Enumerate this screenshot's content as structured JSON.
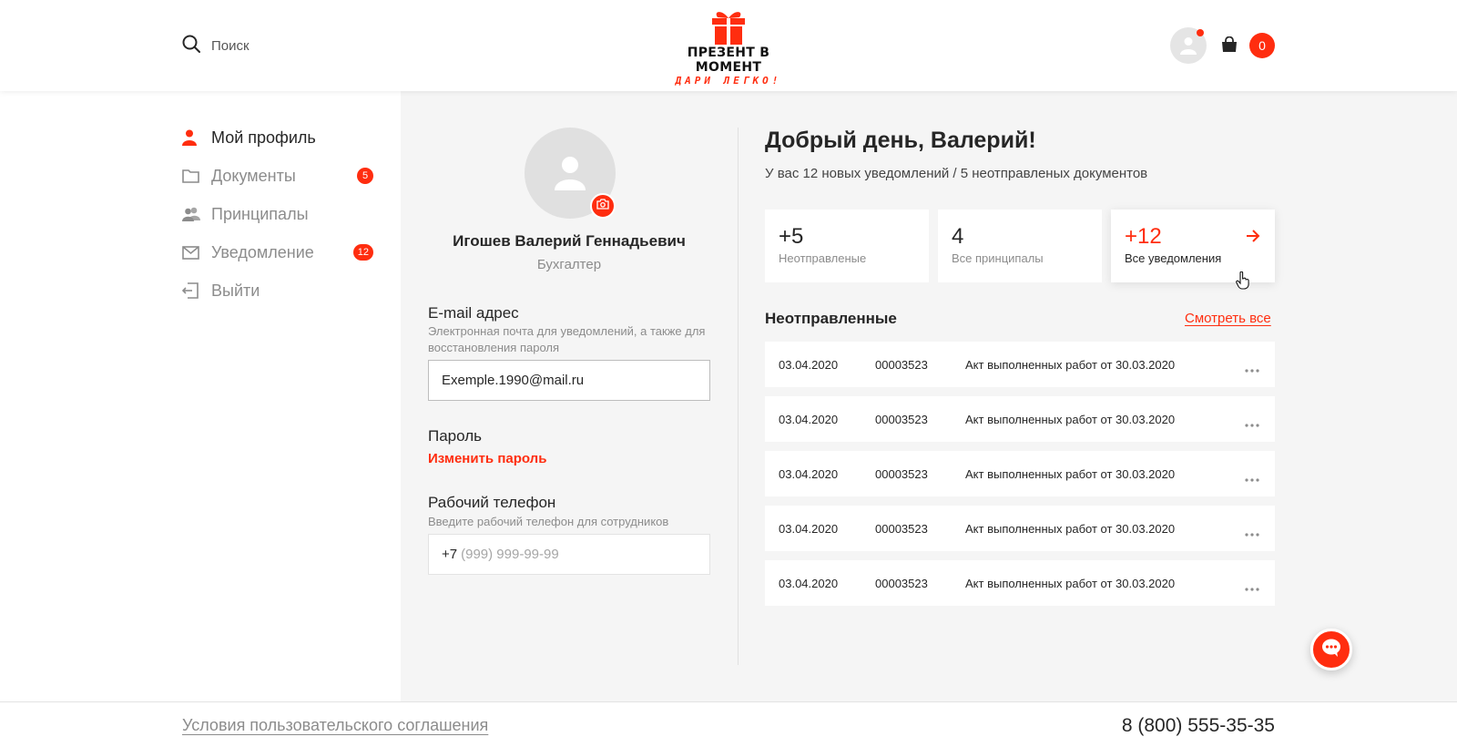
{
  "colors": {
    "accent": "#ff2d0f",
    "sidebar_bg": "#ffffff",
    "main_bg": "#f5f5f5",
    "text": "#262626",
    "muted": "#8c8c8c"
  },
  "header": {
    "search_label": "Поиск",
    "search_icon": "search-icon",
    "logo_title": "ПРЕЗЕНТ В МОМЕНТ",
    "logo_tagline": "ДАРИ ЛЕГКО!",
    "cart_count": "0"
  },
  "sidebar": {
    "items": [
      {
        "label": "Мой профиль",
        "icon": "user-icon",
        "active": true,
        "badge": ""
      },
      {
        "label": "Документы",
        "icon": "folder-icon",
        "active": false,
        "badge": "5"
      },
      {
        "label": "Принципалы",
        "icon": "users-icon",
        "active": false,
        "badge": ""
      },
      {
        "label": "Уведомление",
        "icon": "mail-icon",
        "active": false,
        "badge": "12"
      },
      {
        "label": "Выйти",
        "icon": "logout-icon",
        "active": false,
        "badge": ""
      }
    ]
  },
  "profile": {
    "name": "Игошев Валерий Геннадьевич",
    "role": "Бухгалтер",
    "email": {
      "label": "E-mail адрес",
      "hint": "Электронная почта для уведомлений, а также для восстановления пароля",
      "value": "Exemple.1990@mail.ru"
    },
    "password": {
      "label": "Пароль",
      "change_link": "Изменить пароль"
    },
    "phone": {
      "label": "Рабочий телефон",
      "hint": "Введите рабочий телефон для сотрудников",
      "prefix": "+7",
      "placeholder": "(999) 999-99-99"
    }
  },
  "dashboard": {
    "greeting": "Добрый день, Валерий!",
    "subtitle": "У вас 12 новых уведомлений / 5 неотправленых документов",
    "stats": [
      {
        "value": "+5",
        "label": "Неотправленые"
      },
      {
        "value": "4",
        "label": "Все принципалы"
      },
      {
        "value": "+12",
        "label": "Все уведомления"
      }
    ],
    "unsent_title": "Неотправленные",
    "see_all": "Смотреть все",
    "documents": [
      {
        "date": "03.04.2020",
        "number": "00003523",
        "title": "Акт выполненных работ от 30.03.2020"
      },
      {
        "date": "03.04.2020",
        "number": "00003523",
        "title": "Акт выполненных работ от 30.03.2020"
      },
      {
        "date": "03.04.2020",
        "number": "00003523",
        "title": "Акт выполненных работ от 30.03.2020"
      },
      {
        "date": "03.04.2020",
        "number": "00003523",
        "title": "Акт выполненных работ от 30.03.2020"
      },
      {
        "date": "03.04.2020",
        "number": "00003523",
        "title": "Акт выполненных работ от 30.03.2020"
      }
    ]
  },
  "footer": {
    "agreement_link": "Условия пользовательского соглашения",
    "phone": "8 (800) 555-35-35"
  }
}
